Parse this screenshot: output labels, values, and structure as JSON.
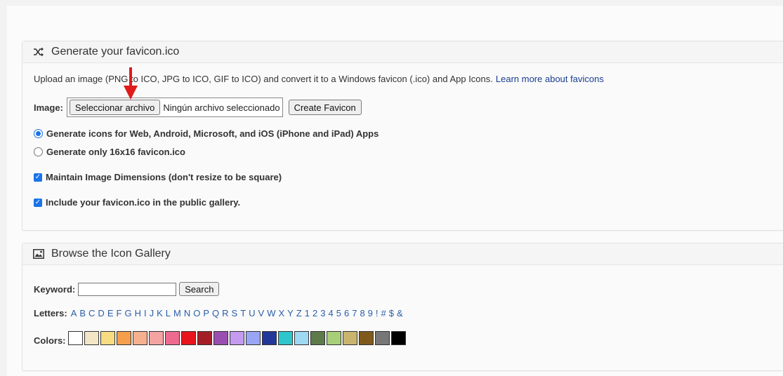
{
  "generate": {
    "title": "Generate your favicon.ico",
    "description": "Upload an image (PNG to ICO, JPG to ICO, GIF to ICO) and convert it to a Windows favicon (.ico) and App Icons.",
    "learn_more": "Learn more about favicons",
    "image_label": "Image:",
    "file_button": "Seleccionar archivo",
    "file_status": "Ningún archivo seleccionado",
    "create_button": "Create Favicon",
    "options": {
      "radio_all": "Generate icons for Web, Android, Microsoft, and iOS (iPhone and iPad) Apps",
      "radio_16": "Generate only 16x16 favicon.ico",
      "check_dimensions": "Maintain Image Dimensions (don't resize to be square)",
      "check_gallery": "Include your favicon.ico in the public gallery."
    }
  },
  "gallery": {
    "title": "Browse the Icon Gallery",
    "keyword_label": "Keyword:",
    "keyword_value": "",
    "search_button": "Search",
    "letters_label": "Letters:",
    "letters": [
      "A",
      "B",
      "C",
      "D",
      "E",
      "F",
      "G",
      "H",
      "I",
      "J",
      "K",
      "L",
      "M",
      "N",
      "O",
      "P",
      "Q",
      "R",
      "S",
      "T",
      "U",
      "V",
      "W",
      "X",
      "Y",
      "Z",
      "1",
      "2",
      "3",
      "4",
      "5",
      "6",
      "7",
      "8",
      "9",
      "!",
      "#",
      "$",
      "&"
    ],
    "colors_label": "Colors:",
    "colors": [
      "#ffffff",
      "#f3e6c7",
      "#f8dc82",
      "#f59f4c",
      "#f5b08f",
      "#f4a3a3",
      "#ee6b8f",
      "#e8141b",
      "#a41f25",
      "#9a4fb0",
      "#c49bf0",
      "#9aa5f5",
      "#23379b",
      "#2ec6cc",
      "#9fd8f2",
      "#5c7a4a",
      "#a7cf78",
      "#c9b46e",
      "#7f5a1c",
      "#777777",
      "#000000"
    ]
  }
}
